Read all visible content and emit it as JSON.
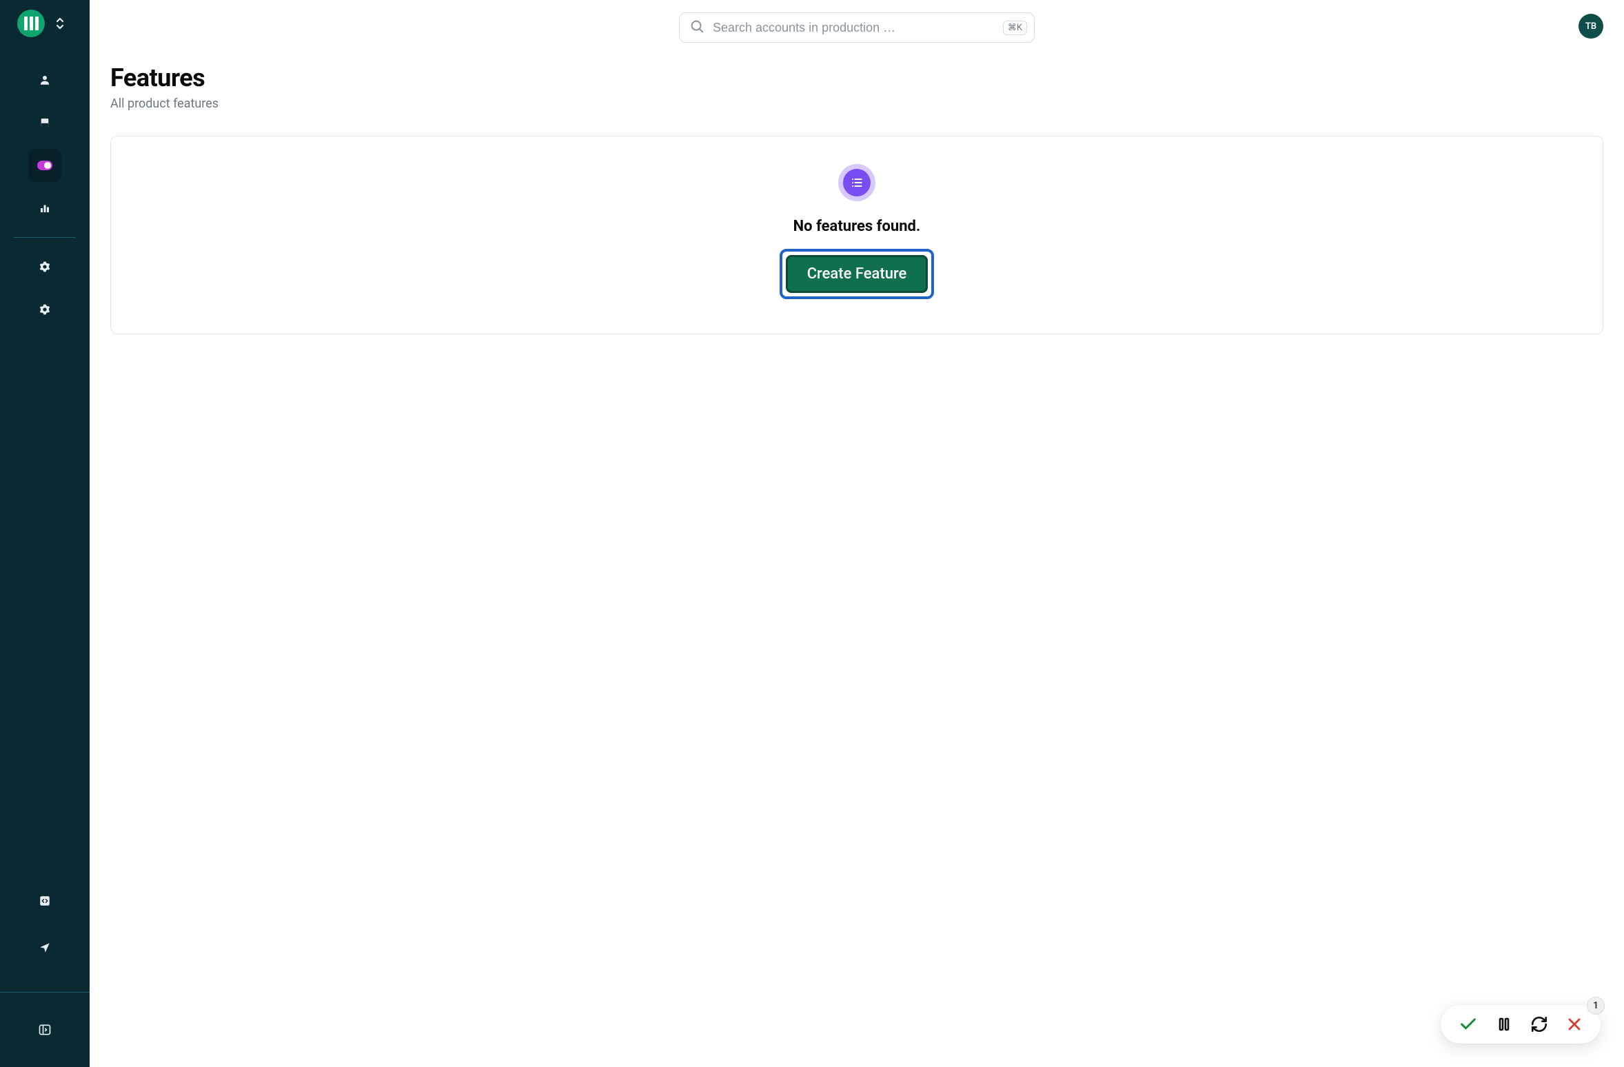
{
  "search": {
    "placeholder": "Search accounts in production …",
    "shortcut": "⌘K"
  },
  "user": {
    "initials": "TB"
  },
  "page": {
    "title": "Features",
    "subtitle": "All product features"
  },
  "empty": {
    "title": "No features found.",
    "cta": "Create Feature"
  },
  "floatbar": {
    "badge": "1"
  },
  "sidebar": {
    "items": [
      {
        "name": "accounts",
        "icon": "user"
      },
      {
        "name": "data",
        "icon": "database"
      },
      {
        "name": "features",
        "icon": "toggle",
        "active": true
      },
      {
        "name": "analytics",
        "icon": "bars"
      }
    ],
    "settings": [
      {
        "name": "settings-1",
        "icon": "gear"
      },
      {
        "name": "settings-2",
        "icon": "gear"
      }
    ],
    "bottom": [
      {
        "name": "dev",
        "icon": "code"
      },
      {
        "name": "send",
        "icon": "send"
      }
    ],
    "footer": {
      "name": "panel-toggle",
      "icon": "panel"
    }
  }
}
